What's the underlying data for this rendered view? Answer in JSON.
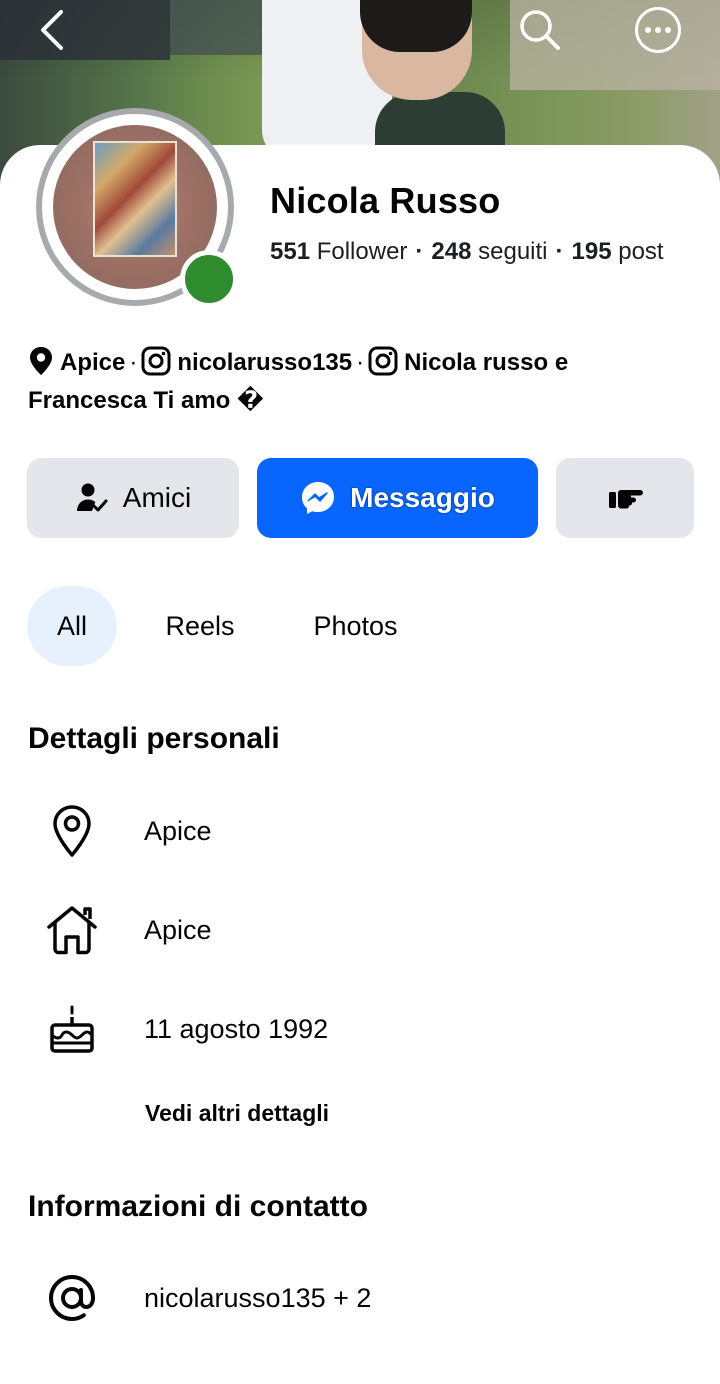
{
  "profile": {
    "name": "Nicola Russo",
    "followers_count": "551",
    "followers_label": "Follower",
    "following_count": "248",
    "following_label": "seguiti",
    "posts_count": "195",
    "posts_label": "post",
    "online": true
  },
  "bio": {
    "location": "Apice",
    "instagram_1": "nicolarusso135",
    "instagram_2_line1": "Nicola russo e",
    "instagram_2_line2": "Francesca Ti amo �"
  },
  "actions": {
    "friends_label": "Amici",
    "message_label": "Messaggio"
  },
  "tabs": [
    {
      "label": "All",
      "active": true
    },
    {
      "label": "Reels",
      "active": false
    },
    {
      "label": "Photos",
      "active": false
    }
  ],
  "personal_details": {
    "title": "Dettagli personali",
    "items": [
      {
        "icon": "location-pin-icon",
        "text": "Apice"
      },
      {
        "icon": "home-icon",
        "text": "Apice"
      },
      {
        "icon": "birthday-cake-icon",
        "text": "11 agosto 1992"
      }
    ],
    "see_more": "Vedi altri dettagli"
  },
  "contact": {
    "title": "Informazioni di contatto",
    "items": [
      {
        "icon": "at-sign-icon",
        "text": "nicolarusso135 + 2"
      }
    ]
  },
  "colors": {
    "primary": "#0866ff",
    "button_gray": "#e4e6eb",
    "tab_active_bg": "#e7f1fe",
    "online": "#2e8c2e"
  }
}
